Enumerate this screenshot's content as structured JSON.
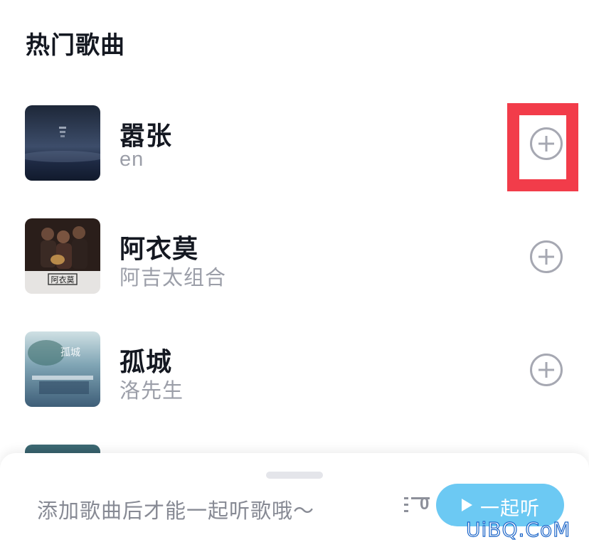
{
  "section_title": "热门歌曲",
  "songs": [
    {
      "title": "嚣张",
      "artist": "en",
      "cover_icon": "album-cover-dark-blue",
      "add_icon": "add-circle-icon"
    },
    {
      "title": "阿衣莫",
      "artist": "阿吉太组合",
      "cover_icon": "album-cover-band-photo",
      "cover_text": "阿衣莫",
      "add_icon": "add-circle-icon"
    },
    {
      "title": "孤城",
      "artist": "洛先生",
      "cover_icon": "album-cover-winter-city",
      "cover_text": "孤城",
      "add_icon": "add-circle-icon"
    }
  ],
  "bottom_panel": {
    "hint": "添加歌曲后才能一起听歌哦～",
    "queue_count": "0",
    "listen_button": "一起听"
  },
  "watermark": "UiBQ.CoM",
  "colors": {
    "highlight": "#f23c4a",
    "listen_button": "#6cc9f3",
    "title": "#141821",
    "muted": "#9b9ea8"
  }
}
